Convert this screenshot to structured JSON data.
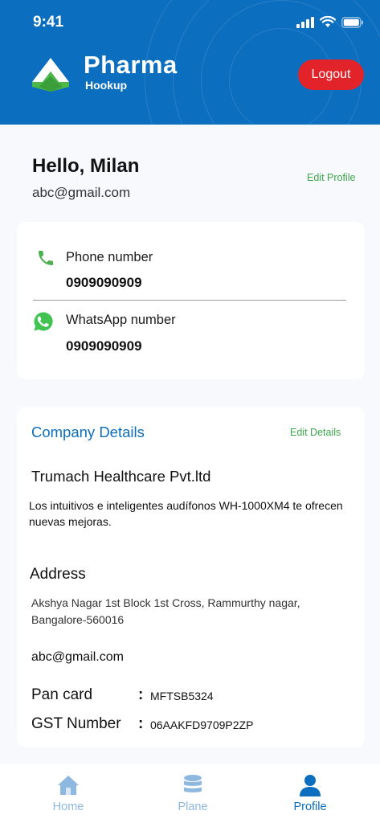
{
  "status_bar": {
    "time": "9:41"
  },
  "brand": {
    "name": "Pharma",
    "tagline": "Hookup"
  },
  "header": {
    "logout_label": "Logout"
  },
  "profile": {
    "greeting": "Hello, Milan",
    "email": "abc@gmail.com",
    "edit_label": "Edit Profile"
  },
  "contact": {
    "phone_label": "Phone number",
    "phone_value": "0909090909",
    "whatsapp_label": "WhatsApp number",
    "whatsapp_value": "0909090909"
  },
  "company": {
    "section_title": "Company Details",
    "edit_label": "Edit Details",
    "name": "Trumach Healthcare Pvt.ltd",
    "description": "Los intuitivos e inteligentes audífonos WH-1000XM4 te ofrecen nuevas mejoras.",
    "address_title": "Address",
    "address": "Akshya Nagar 1st Block 1st Cross, Rammurthy nagar, Bangalore-560016",
    "email": "abc@gmail.com",
    "pan_label": "Pan card",
    "pan_value": "MFTSB5324",
    "gst_label": "GST Number",
    "gst_value": "06AAKFD9709P2ZP",
    "separator": ":"
  },
  "nav": {
    "items": [
      {
        "label": "Home",
        "icon": "home-icon"
      },
      {
        "label": "Plane",
        "icon": "database-icon"
      },
      {
        "label": "Profile",
        "icon": "user-icon"
      }
    ],
    "active_index": 2
  },
  "colors": {
    "primary": "#0c6ebf",
    "accent_green": "#3ca64b",
    "logout_red": "#e3232a",
    "nav_inactive": "#8fb8e0"
  }
}
